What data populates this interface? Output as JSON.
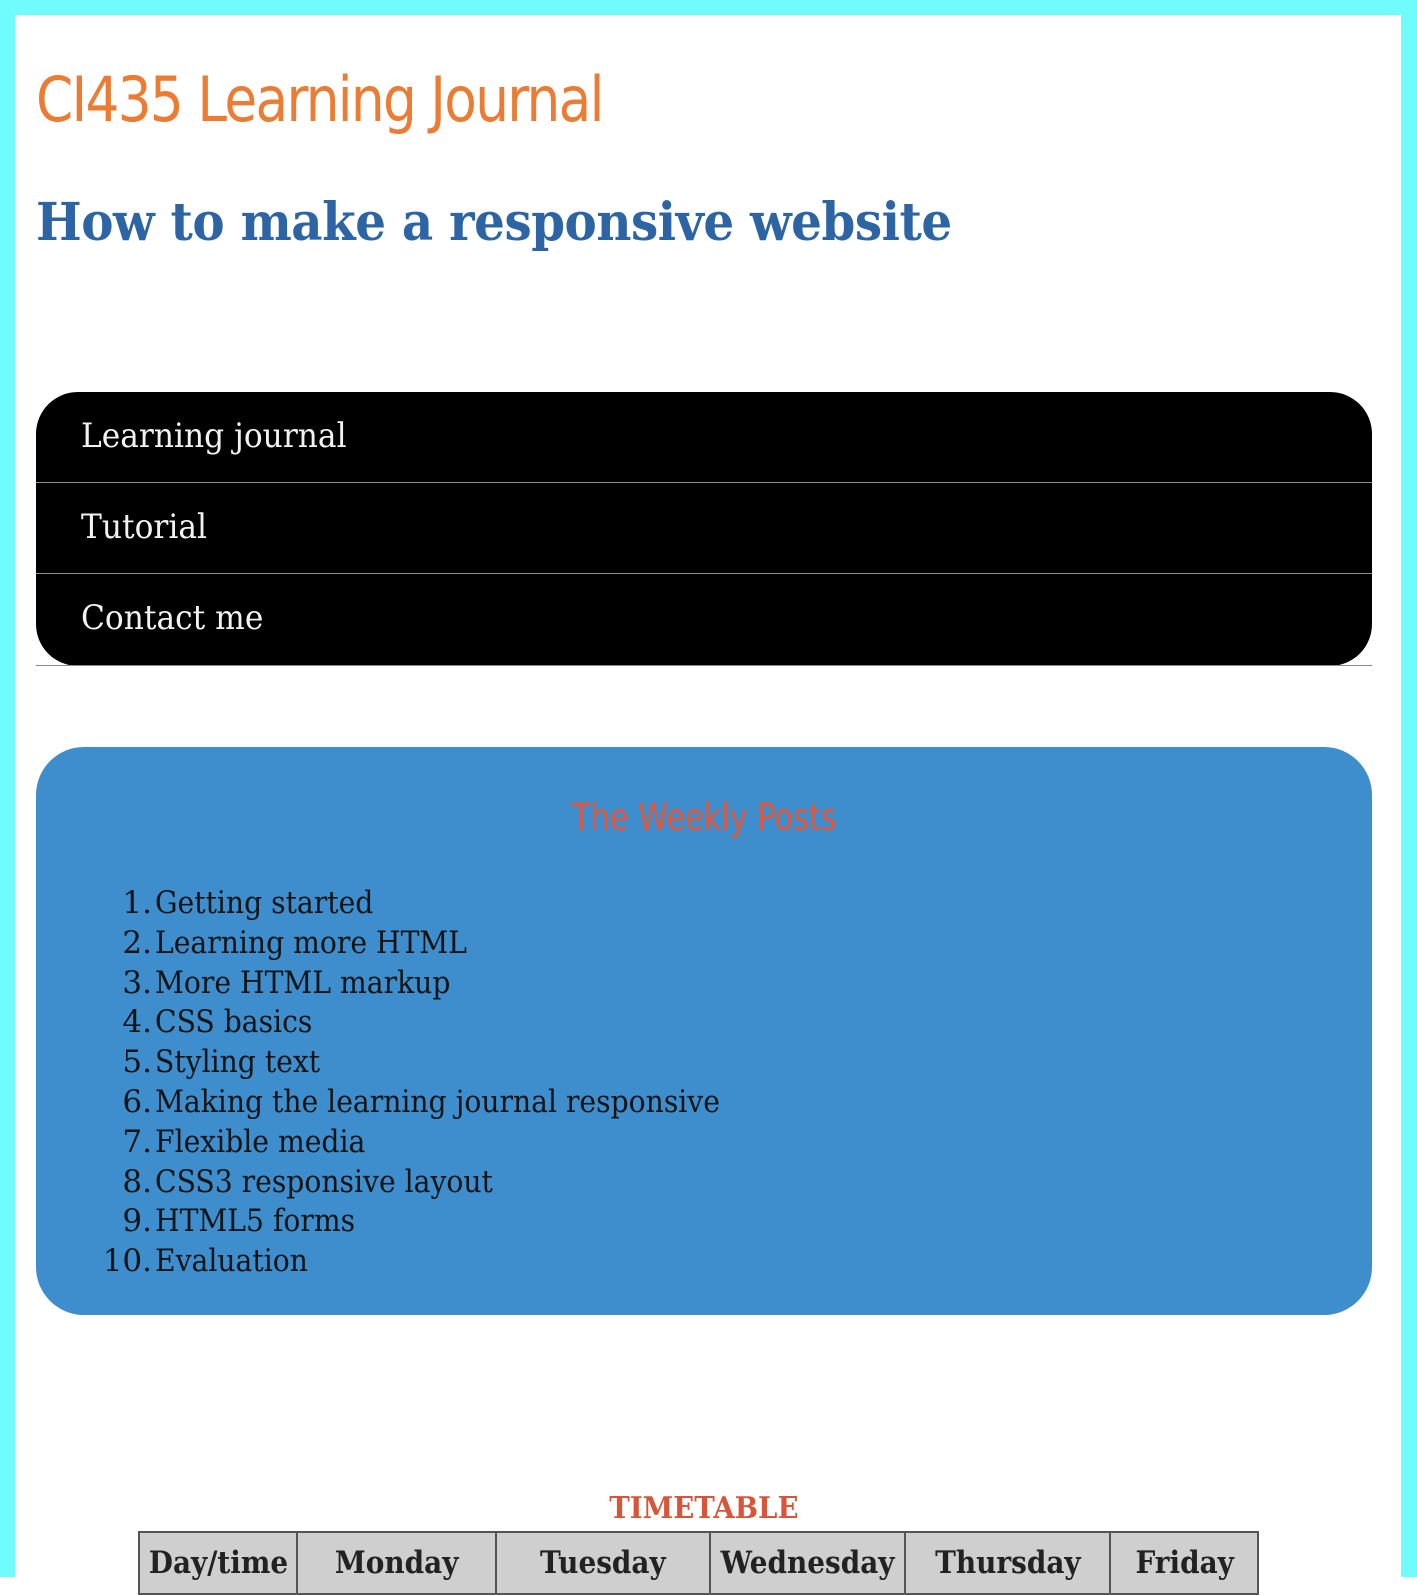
{
  "header": {
    "site_title": "CI435 Learning Journal",
    "page_title": "How to make a responsive website"
  },
  "nav": {
    "items": [
      {
        "label": "Learning journal"
      },
      {
        "label": "Tutorial"
      },
      {
        "label": "Contact me"
      }
    ]
  },
  "weekly_posts": {
    "heading": "The Weekly Posts",
    "items": [
      {
        "number": "1.",
        "title": "Getting started"
      },
      {
        "number": "2.",
        "title": "Learning more HTML"
      },
      {
        "number": "3.",
        "title": "More HTML markup"
      },
      {
        "number": "4.",
        "title": "CSS basics"
      },
      {
        "number": "5.",
        "title": "Styling text"
      },
      {
        "number": "6.",
        "title": "Making the learning journal responsive"
      },
      {
        "number": "7.",
        "title": "Flexible media"
      },
      {
        "number": "8.",
        "title": "CSS3 responsive layout"
      },
      {
        "number": "9.",
        "title": "HTML5 forms"
      },
      {
        "number": "10.",
        "title": "Evaluation"
      }
    ]
  },
  "timetable": {
    "title": "TIMETABLE",
    "headers": [
      "Day/time",
      "Monday",
      "Tuesday",
      "Wednesday",
      "Thursday",
      "Friday"
    ]
  },
  "colors": {
    "frame": "#70fbfd",
    "site_title": "#ec7b33",
    "page_title": "#2d65a4",
    "nav_background": "#000000",
    "posts_background": "#3e8dcc",
    "posts_heading": "#e2573b",
    "timetable_title": "#d8553a"
  }
}
